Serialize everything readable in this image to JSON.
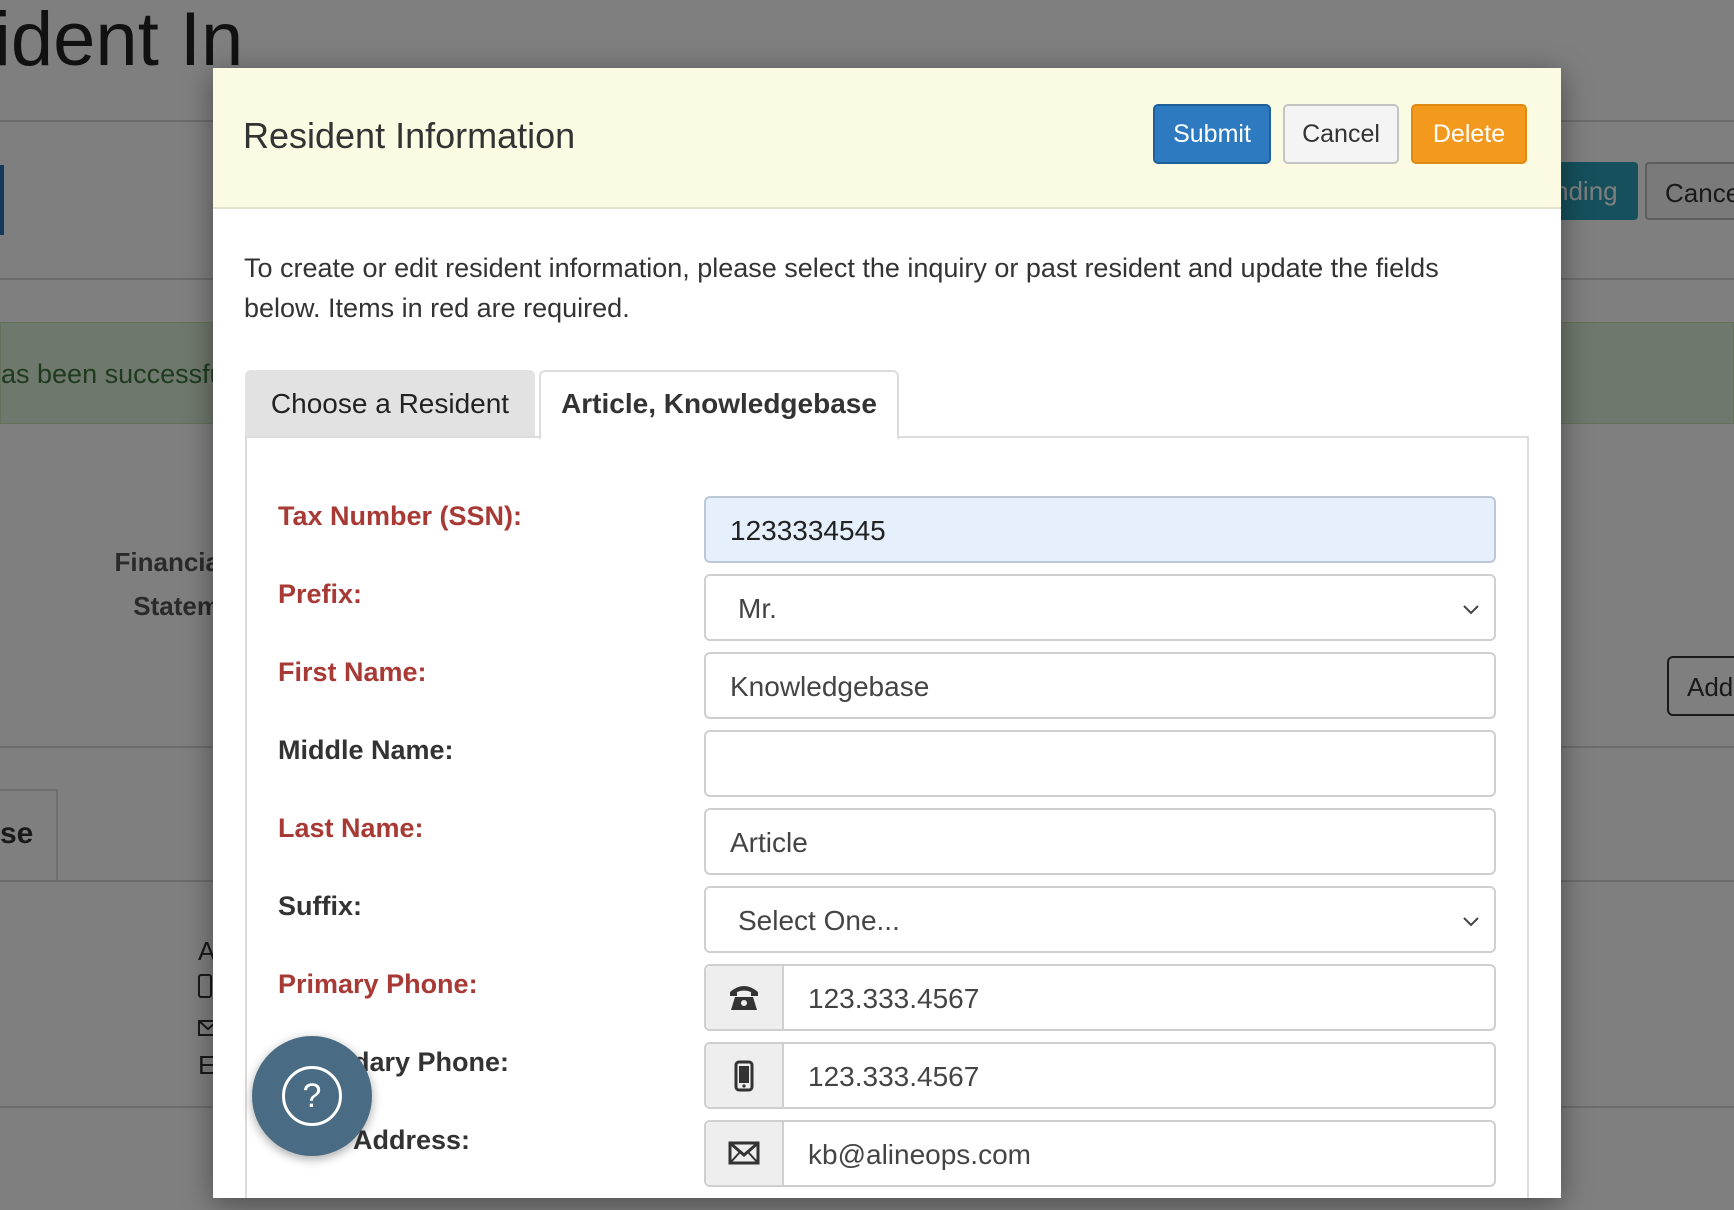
{
  "background": {
    "page_title": "ident In",
    "alert_text": "as been successfu",
    "financial_label_line1": "Financia",
    "financial_label_line2": "Statem",
    "tab_partial": "se",
    "pending_button": "nding",
    "cancel_button": "Cance",
    "add_button": "Add",
    "partial_letters": [
      "A",
      "",
      "",
      "E"
    ]
  },
  "modal": {
    "title": "Resident Information",
    "buttons": {
      "submit": "Submit",
      "cancel": "Cancel",
      "delete": "Delete"
    },
    "intro": "To create or edit resident information, please select the inquiry or past resident and update the fields below. Items in red are required.",
    "tabs": {
      "choose_resident": "Choose a Resident",
      "active_resident": "Article, Knowledgebase"
    },
    "fields": {
      "tax_number": {
        "label": "Tax Number (SSN):",
        "value": "1233334545"
      },
      "prefix": {
        "label": "Prefix:",
        "value": "Mr."
      },
      "first_name": {
        "label": "First Name:",
        "value": "Knowledgebase"
      },
      "middle_name": {
        "label": "Middle Name:",
        "value": ""
      },
      "last_name": {
        "label": "Last Name:",
        "value": "Article"
      },
      "suffix": {
        "label": "Suffix:",
        "value": "Select One..."
      },
      "primary_phone": {
        "label": "Primary Phone:",
        "value": "123.333.4567",
        "icon": "phone-icon"
      },
      "secondary_phone": {
        "label": "dary Phone:",
        "value": "123.333.4567",
        "icon": "mobile-icon"
      },
      "email_address": {
        "label": "Address:",
        "value": "kb@alineops.com",
        "icon": "envelope-icon"
      }
    }
  },
  "help_button": {
    "symbol": "?"
  },
  "colors": {
    "required_label": "#a83a36",
    "submit": "#2d7ac0",
    "delete": "#f39a1e",
    "header_bg": "#fbfbe3",
    "focused_field": "#e6f0fc",
    "help_button": "#4a6b84"
  }
}
